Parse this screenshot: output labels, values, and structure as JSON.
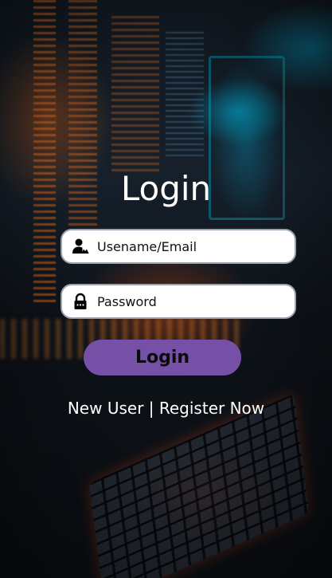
{
  "login": {
    "title": "Login",
    "username_placeholder": "Usename/Email",
    "password_placeholder": "Password",
    "username_icon": "user-icon",
    "password_icon": "lock-icon",
    "button_label": "Login",
    "new_user_text": "New User",
    "separator": " | ",
    "register_link": "Register Now"
  },
  "colors": {
    "button": "#7550a6",
    "field_border": "#9aa3ad"
  },
  "background": {
    "description_icon": "code-monitors-keyboard-background"
  }
}
